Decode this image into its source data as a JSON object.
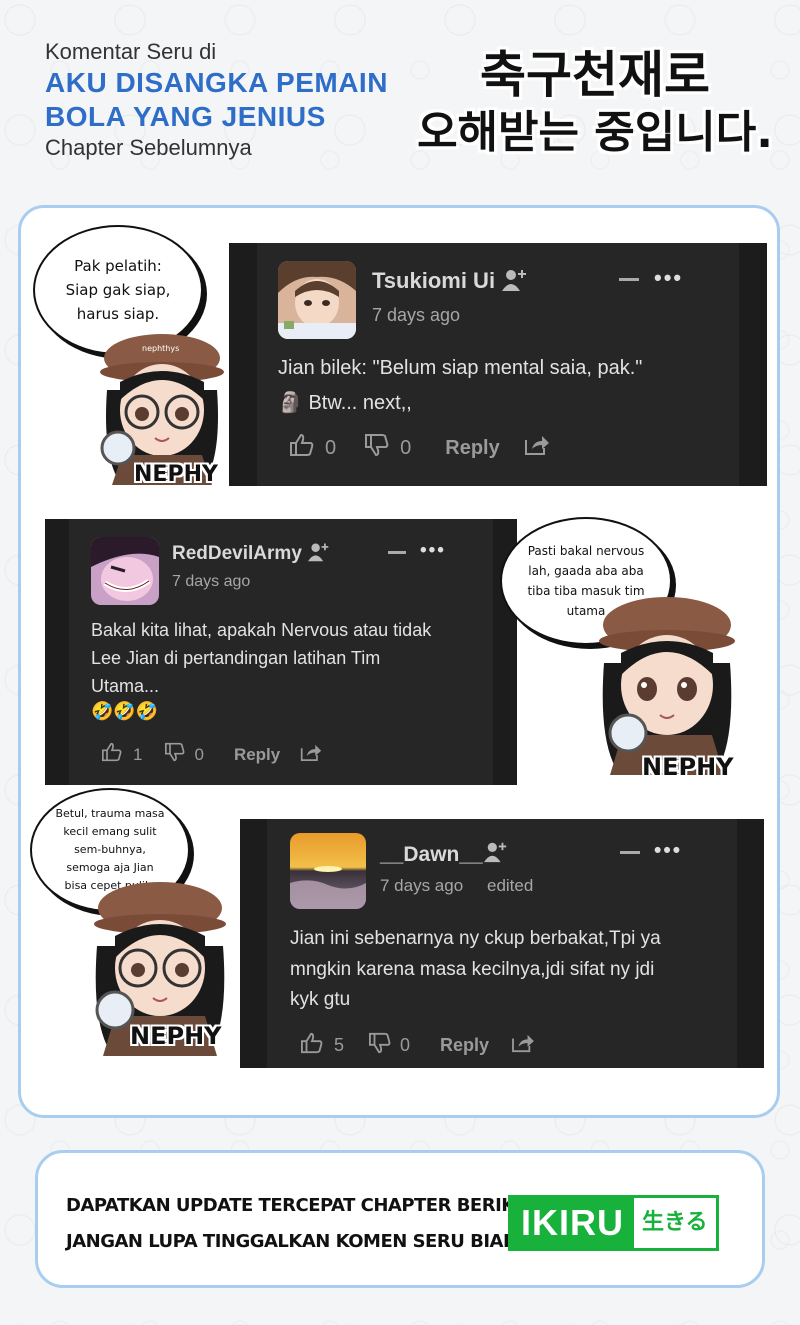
{
  "header": {
    "line1": "Komentar Seru di",
    "title_line1": "AKU DISANGKA PEMAIN",
    "title_line2": "BOLA YANG JENIUS",
    "line4": "Chapter Sebelumnya",
    "korean_line1": "축구천재로",
    "korean_line2": "오해받는 중입니다."
  },
  "comments": [
    {
      "username": "Tsukiomi Ui",
      "time": "7 days ago",
      "text_line1": "Jian bilek: \"Belum siap mental saia, pak.\"",
      "text_line2": "🗿 Btw... next,,",
      "likes": "0",
      "dislikes": "0",
      "reply": "Reply",
      "bubble_text": "Pak pelatih: Siap gak siap, harus siap."
    },
    {
      "username": "RedDevilArmy",
      "time": "7 days ago",
      "text_line1": "Bakal kita lihat, apakah Nervous atau tidak",
      "text_line2": "Lee Jian di pertandingan latihan Tim",
      "text_line3": "Utama...",
      "text_line4": "🤣🤣🤣",
      "likes": "1",
      "dislikes": "0",
      "reply": "Reply",
      "bubble_text": "Pasti bakal nervous lah, gaada aba aba tiba tiba masuk tim utama"
    },
    {
      "username": "__Dawn__",
      "time": "7 days ago",
      "edited": "edited",
      "text_line1": "Jian ini sebenarnya ny ckup berbakat,Tpi ya",
      "text_line2": "mngkin karena masa kecilnya,jdi sifat ny jdi",
      "text_line3": "kyk gtu",
      "likes": "5",
      "dislikes": "0",
      "reply": "Reply",
      "bubble_text": "Betul, trauma masa kecil emang sulit sem-buhnya, semoga aja Jian bisa cepet pulih."
    }
  ],
  "character": {
    "name": "NEPHY",
    "hat_text": "nephthys"
  },
  "footer": {
    "line1": "DAPATKAN UPDATE TERCEPAT CHAPTER BERIKUTNYA DI",
    "line2": "JANGAN LUPA TINGGALKAN KOMEN SERU BIAR DI NOTIS",
    "brand": "IKIRU",
    "brand_sub": "生きる"
  },
  "colors": {
    "accent_blue": "#2e6ec8",
    "panel_border": "#a9cdf0",
    "brand_green": "#17b13b",
    "card_bg": "#1c1c1c"
  }
}
